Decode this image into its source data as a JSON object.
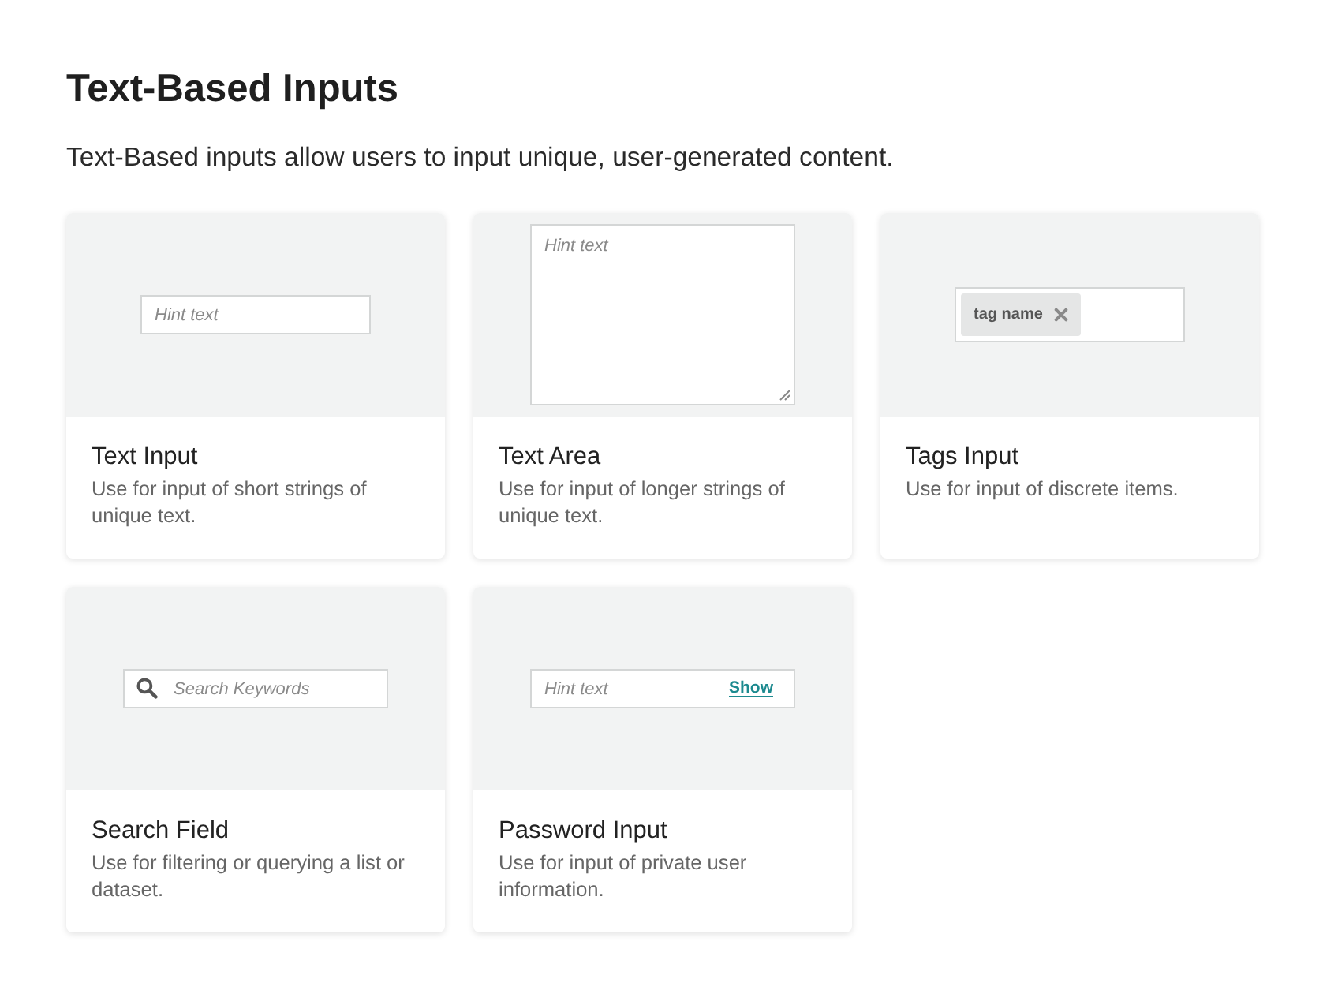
{
  "heading": "Text-Based Inputs",
  "intro": "Text-Based inputs allow users to input unique, user-generated content.",
  "cards": [
    {
      "kind": "text_input",
      "title": "Text Input",
      "description": "Use for input of short strings of unique text.",
      "placeholder": "Hint text"
    },
    {
      "kind": "text_area",
      "title": "Text Area",
      "description": "Use for input of longer strings of unique text.",
      "placeholder": "Hint text"
    },
    {
      "kind": "tags_input",
      "title": "Tags Input",
      "description": "Use for input of discrete items.",
      "tags": [
        {
          "label": "tag name"
        }
      ]
    },
    {
      "kind": "search_field",
      "title": "Search Field",
      "description": "Use for filtering or querying a list or dataset.",
      "placeholder": "Search Keywords"
    },
    {
      "kind": "password_input",
      "title": "Password Input",
      "description": "Use for input of private user information.",
      "placeholder": "Hint text",
      "toggle_label": "Show"
    }
  ]
}
